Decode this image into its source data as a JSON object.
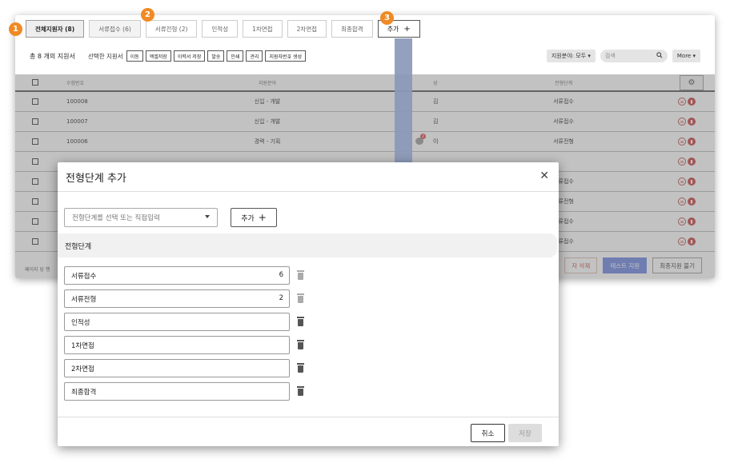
{
  "tabs": [
    {
      "label": "전체지원자 (8)"
    },
    {
      "label": "서류접수 (6)"
    },
    {
      "label": "서류전형 (2)"
    },
    {
      "label": "인적성"
    },
    {
      "label": "1차면접"
    },
    {
      "label": "2차면접"
    },
    {
      "label": "최종합격"
    },
    {
      "label": "추가"
    }
  ],
  "callouts": [
    "1",
    "2",
    "3"
  ],
  "toolbar": {
    "total": "총 8 개의 지원서",
    "selected_label": "선택한 지원서",
    "actions": [
      "이동",
      "엑셀저장",
      "이력서 저장",
      "발송",
      "인쇄",
      "관리",
      "지원자번호 생성"
    ],
    "filter": "지원분야: 모두",
    "search_placeholder": "검색",
    "more": "More"
  },
  "table": {
    "headers": {
      "num": "수험번호",
      "field": "지원분야",
      "name": "성",
      "stage": "전형단계"
    },
    "rows": [
      {
        "num": "100008",
        "field": "신입 - 개발",
        "name": "김",
        "stage": "서류접수"
      },
      {
        "num": "100007",
        "field": "신입 - 개발",
        "name": "김",
        "stage": "서류접수"
      },
      {
        "num": "100006",
        "field": "경력 - 기획",
        "name": "이",
        "stage": "서류전형",
        "badge": "2"
      },
      {
        "num": "",
        "field": "",
        "name": "",
        "stage": ""
      },
      {
        "num": "",
        "field": "",
        "name": "",
        "stage": "서류접수"
      },
      {
        "num": "",
        "field": "",
        "name": "",
        "stage": "서류전형"
      },
      {
        "num": "",
        "field": "",
        "name": "",
        "stage": "서류접수"
      },
      {
        "num": "",
        "field": "",
        "name": "",
        "stage": "서류접수"
      }
    ]
  },
  "footer": {
    "per_page": "페이지 당 행",
    "delete_label": "자 삭제",
    "test_label": "테스트 지원",
    "final_label": "최종지원 불기"
  },
  "modal": {
    "title": "전형단계 추가",
    "select_placeholder": "전형단계를 선택 또는 직접입력",
    "add_label": "추가",
    "section_title": "전형단계",
    "stages": [
      {
        "label": "서류접수",
        "count": "6"
      },
      {
        "label": "서류전형",
        "count": "2"
      },
      {
        "label": "인적성",
        "count": ""
      },
      {
        "label": "1차면접",
        "count": ""
      },
      {
        "label": "2차면접",
        "count": ""
      },
      {
        "label": "최종합격",
        "count": ""
      }
    ],
    "cancel_label": "취소",
    "save_label": "저장"
  }
}
